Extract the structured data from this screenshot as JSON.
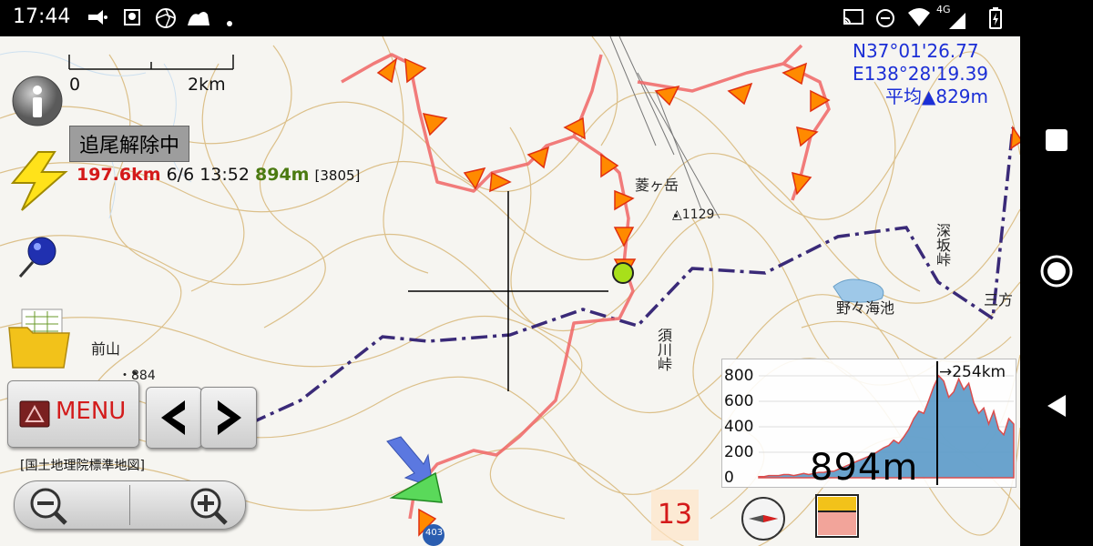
{
  "status_bar": {
    "time": "17:44",
    "left_icons": [
      "voicemail-icon",
      "maps-notification-icon",
      "aperture-icon",
      "dog-icon",
      "dot-icon"
    ],
    "right_icons": [
      "cast-icon",
      "dnd-icon",
      "wifi-icon",
      "signal-4g-icon",
      "battery-charging-icon"
    ],
    "network": "4G"
  },
  "scale": {
    "start": "0",
    "end": "2km"
  },
  "coordinates": {
    "lat": "N37°01'26.77",
    "lon": "E138°28'19.39",
    "avg_label": "平均▲829m"
  },
  "tracking_status": "追尾解除中",
  "stats": {
    "distance": "197.6km",
    "datetime": "6/6 13:52",
    "altitude": "894m",
    "count": "[3805]"
  },
  "menu_label": "MENU",
  "map_source": "[国土地理院標準地図]",
  "place_labels": {
    "mountain1": "菱ヶ岳",
    "peak1": "1129",
    "pass1": "須川峠",
    "pond": "野々海池",
    "pass2": "深坂峠",
    "mountain2": "前山",
    "peak2": "884",
    "town": "三方",
    "route": "403"
  },
  "elevation": {
    "ticks": [
      "800",
      "600",
      "400",
      "200",
      "0"
    ],
    "distance_marker": "→254km",
    "current_alt": "894m",
    "profile": [
      0.01,
      0.01,
      0.02,
      0.02,
      0.02,
      0.03,
      0.03,
      0.02,
      0.03,
      0.04,
      0.03,
      0.04,
      0.05,
      0.05,
      0.06,
      0.06,
      0.08,
      0.1,
      0.12,
      0.14,
      0.16,
      0.18,
      0.2,
      0.22,
      0.25,
      0.28,
      0.3,
      0.35,
      0.32,
      0.38,
      0.45,
      0.55,
      0.62,
      0.6,
      0.72,
      0.85,
      0.95,
      0.9,
      0.75,
      0.8,
      0.92,
      0.82,
      0.88,
      0.7,
      0.6,
      0.65,
      0.5,
      0.62,
      0.45,
      0.4,
      0.55,
      0.5
    ]
  },
  "zoom_level": "13",
  "colors": {
    "track": "#f05050",
    "arrow_fill": "#ff8a00",
    "boundary": "#3a2a78",
    "contour": "#d9b97a",
    "coord_text": "#1c2fd6",
    "distance_text": "#d41a1a",
    "altitude_text": "#4b7a11"
  }
}
